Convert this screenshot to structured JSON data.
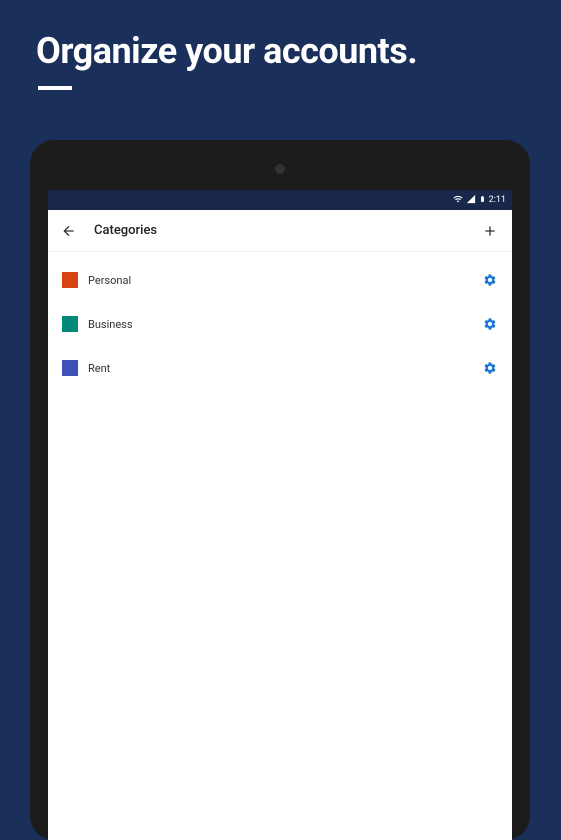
{
  "hero": {
    "title": "Organize your accounts."
  },
  "status": {
    "time": "2:11"
  },
  "appBar": {
    "title": "Categories"
  },
  "categories": [
    {
      "label": "Personal",
      "color": "#d84315"
    },
    {
      "label": "Business",
      "color": "#00897b"
    },
    {
      "label": "Rent",
      "color": "#3f51b5"
    }
  ],
  "colors": {
    "gear": "#1976d2"
  }
}
